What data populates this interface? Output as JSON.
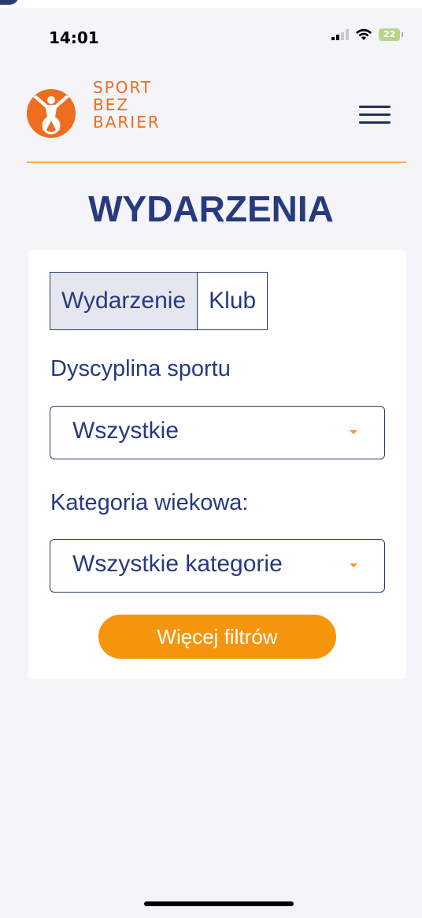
{
  "status_bar": {
    "time": "14:01",
    "battery": "22"
  },
  "brand": {
    "line1": "SPORT",
    "line2": "BEZ",
    "line3": "BARIER",
    "color": "#ee6d1e"
  },
  "page": {
    "title": "WYDARZENIA"
  },
  "tabs": [
    {
      "label": "Wydarzenie",
      "active": true
    },
    {
      "label": "Klub",
      "active": false
    }
  ],
  "filters": {
    "discipline": {
      "label": "Dyscyplina sportu",
      "value": "Wszystkie"
    },
    "age": {
      "label": "Kategoria wiekowa:",
      "value": "Wszystkie kategorie"
    }
  },
  "more_filters_label": "Więcej filtrów",
  "colors": {
    "accent": "#f5950e",
    "navy": "#273a7e",
    "divider": "#f0b04b"
  }
}
